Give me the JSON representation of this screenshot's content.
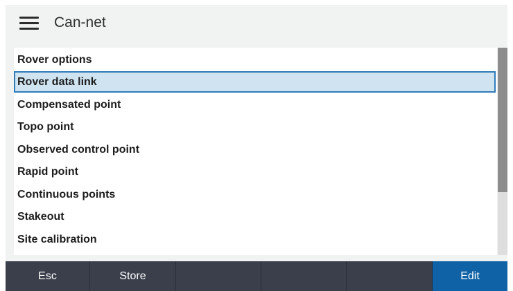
{
  "header": {
    "menu_icon": "hamburger-menu-icon",
    "title": "Can-net"
  },
  "list": {
    "selected_index": 1,
    "items": [
      {
        "label": "Rover options"
      },
      {
        "label": "Rover data link"
      },
      {
        "label": "Compensated point"
      },
      {
        "label": "Topo point"
      },
      {
        "label": "Observed control point"
      },
      {
        "label": "Rapid point"
      },
      {
        "label": "Continuous points"
      },
      {
        "label": "Stakeout"
      },
      {
        "label": "Site calibration"
      }
    ]
  },
  "softkeys": [
    {
      "label": "Esc"
    },
    {
      "label": "Store"
    },
    {
      "label": ""
    },
    {
      "label": ""
    },
    {
      "label": ""
    },
    {
      "label": "Edit"
    }
  ],
  "colors": {
    "selection_fill": "#cfe3f1",
    "selection_border": "#2f7bb8",
    "softkey_bar": "#3a3f4b",
    "primary_softkey": "#0f62a6"
  }
}
